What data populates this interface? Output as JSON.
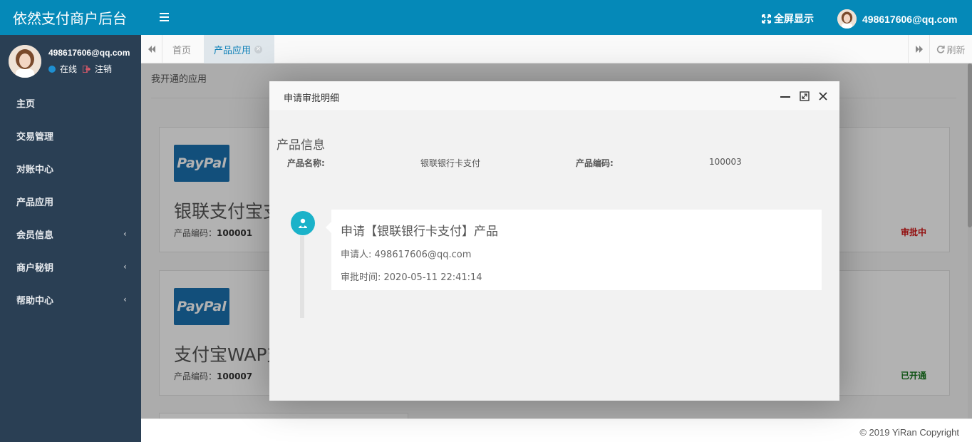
{
  "brand": {
    "title": "依然支付商户后台"
  },
  "user": {
    "name": "498617606@qq.com",
    "status": "在线",
    "logout": "注销"
  },
  "sidebar": {
    "items": [
      {
        "label": "主页",
        "has_children": false
      },
      {
        "label": "交易管理",
        "has_children": false
      },
      {
        "label": "对账中心",
        "has_children": false
      },
      {
        "label": "产品应用",
        "has_children": false
      },
      {
        "label": "会员信息",
        "has_children": true
      },
      {
        "label": "商户秘钥",
        "has_children": true
      },
      {
        "label": "帮助中心",
        "has_children": true
      }
    ]
  },
  "header": {
    "fullscreen": "全屏显示",
    "user_name": "498617606@qq.com"
  },
  "tabs": {
    "items": [
      {
        "label": "首页"
      },
      {
        "label": "产品应用"
      }
    ],
    "refresh": "刷新"
  },
  "content": {
    "title": "我开通的应用",
    "cards": [
      {
        "logo_text": "PayPal",
        "name": "银联支付宝支",
        "code_label": "产品编码：",
        "code": "100001",
        "status": "审批中",
        "status_color": "#d21414"
      },
      {
        "logo_text": "PayPal",
        "name": "支付宝WAP支",
        "code_label": "产品编码：",
        "code": "100007",
        "status": "已开通",
        "status_color": "#16781e"
      }
    ]
  },
  "modal": {
    "title": "申请审批明细",
    "section": "产品信息",
    "product_name_label": "产品名称:",
    "product_name": "银联银行卡支付",
    "product_code_label": "产品编码:",
    "product_code": "100003",
    "timeline": {
      "title": "申请【银联银行卡支付】产品",
      "applicant": "申请人: 498617606@qq.com",
      "time": "审批时间: 2020-05-11 22:41:14"
    }
  },
  "footer": {
    "copyright": "© 2019 YiRan Copyright"
  },
  "colors": {
    "brand_blue": "#0589b8",
    "sidebar_bg": "#2a3f54",
    "timeline_accent": "#1ab2c9"
  }
}
